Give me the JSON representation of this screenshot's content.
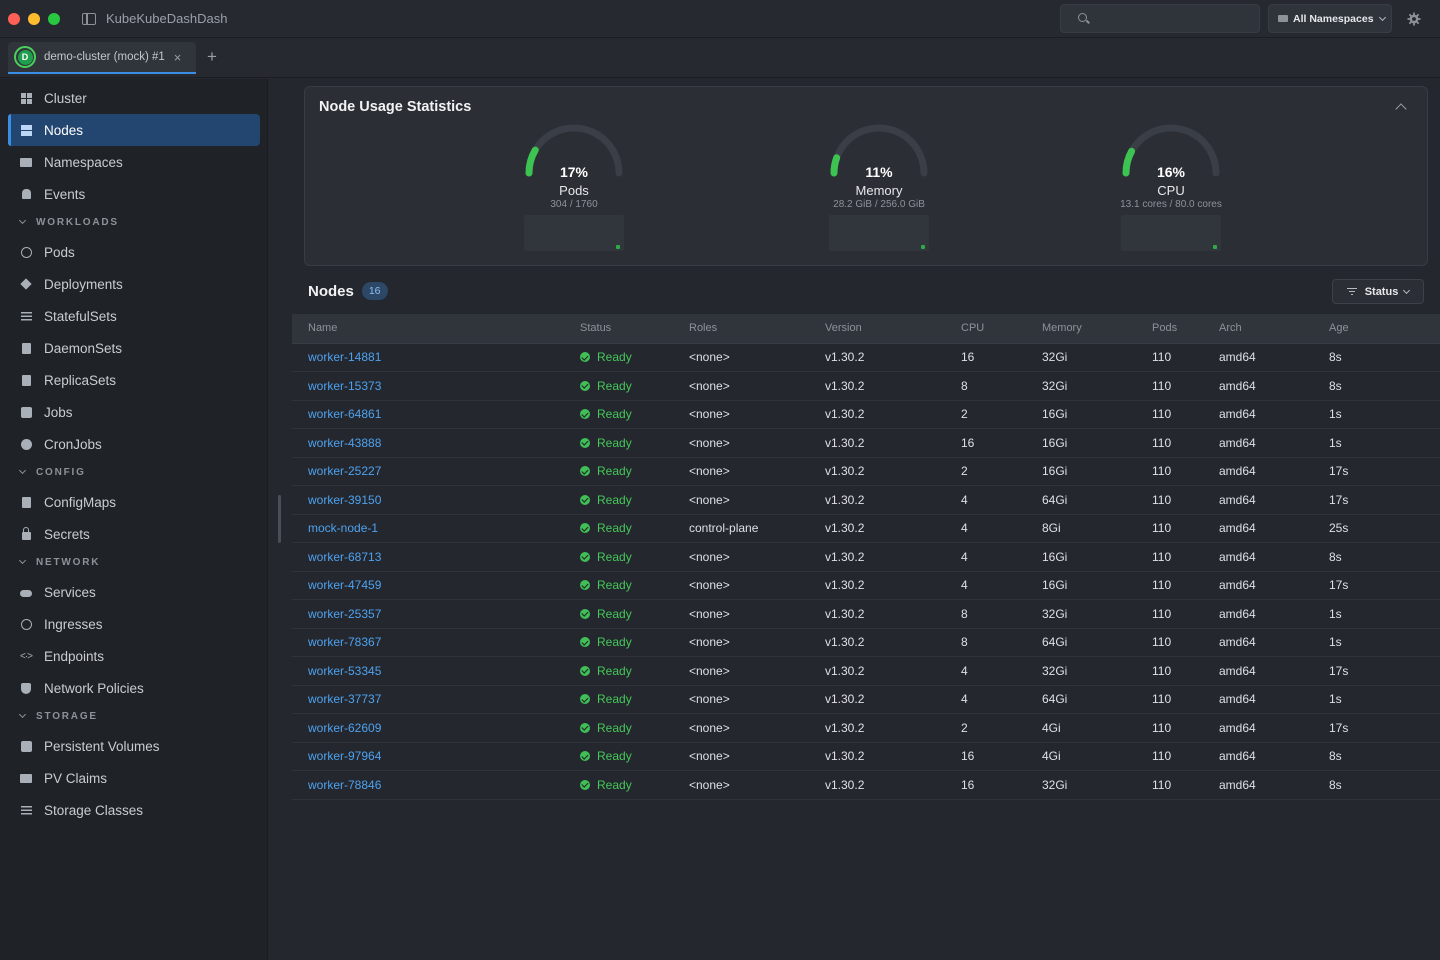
{
  "window": {
    "title": "KubeKubeDashDash"
  },
  "header": {
    "search": {
      "value": "",
      "placeholder": ""
    },
    "namespace_select": "All Namespaces"
  },
  "tabs": [
    {
      "label": "demo-cluster (mock) #1",
      "avatar_letter": "D",
      "active": true
    }
  ],
  "sidebar": {
    "items": [
      {
        "label": "Cluster",
        "icon": "grid-icon"
      },
      {
        "label": "Nodes",
        "icon": "server-icon",
        "active": true
      },
      {
        "label": "Namespaces",
        "icon": "folder-icon"
      },
      {
        "label": "Events",
        "icon": "bell-icon"
      }
    ],
    "sections": [
      {
        "title": "WORKLOADS",
        "items": [
          {
            "label": "Pods",
            "icon": "pod-icon"
          },
          {
            "label": "Deployments",
            "icon": "layers-icon"
          },
          {
            "label": "StatefulSets",
            "icon": "list-icon"
          },
          {
            "label": "DaemonSets",
            "icon": "copy-icon"
          },
          {
            "label": "ReplicaSets",
            "icon": "doc-icon"
          },
          {
            "label": "Jobs",
            "icon": "briefcase-icon"
          },
          {
            "label": "CronJobs",
            "icon": "clock-icon"
          }
        ]
      },
      {
        "title": "CONFIG",
        "items": [
          {
            "label": "ConfigMaps",
            "icon": "file-icon"
          },
          {
            "label": "Secrets",
            "icon": "lock-icon"
          }
        ]
      },
      {
        "title": "NETWORK",
        "items": [
          {
            "label": "Services",
            "icon": "cloud-icon"
          },
          {
            "label": "Ingresses",
            "icon": "globe-icon"
          },
          {
            "label": "Endpoints",
            "icon": "code-icon"
          },
          {
            "label": "Network Policies",
            "icon": "shield-icon"
          }
        ]
      },
      {
        "title": "STORAGE",
        "items": [
          {
            "label": "Persistent Volumes",
            "icon": "disk-icon"
          },
          {
            "label": "PV Claims",
            "icon": "folder-open-icon"
          },
          {
            "label": "Storage Classes",
            "icon": "list-icon"
          }
        ]
      }
    ]
  },
  "stats": {
    "title": "Node Usage Statistics",
    "gauges": [
      {
        "percent_label": "17%",
        "percent": 17,
        "label": "Pods",
        "detail": "304 / 1760"
      },
      {
        "percent_label": "11%",
        "percent": 11,
        "label": "Memory",
        "detail": "28.2 GiB / 256.0 GiB"
      },
      {
        "percent_label": "16%",
        "percent": 16,
        "label": "CPU",
        "detail": "13.1 cores / 80.0 cores"
      }
    ],
    "colors": {
      "track": "#3a3e46",
      "fill": "#3cc351"
    }
  },
  "nodes": {
    "title": "Nodes",
    "count": "16",
    "filter_label": "Status",
    "columns": [
      "Name",
      "Status",
      "Roles",
      "Version",
      "CPU",
      "Memory",
      "Pods",
      "Arch",
      "Age"
    ],
    "rows": [
      [
        "worker-14881",
        "Ready",
        "<none>",
        "v1.30.2",
        "16",
        "32Gi",
        "110",
        "amd64",
        "8s"
      ],
      [
        "worker-15373",
        "Ready",
        "<none>",
        "v1.30.2",
        "8",
        "32Gi",
        "110",
        "amd64",
        "8s"
      ],
      [
        "worker-64861",
        "Ready",
        "<none>",
        "v1.30.2",
        "2",
        "16Gi",
        "110",
        "amd64",
        "1s"
      ],
      [
        "worker-43888",
        "Ready",
        "<none>",
        "v1.30.2",
        "16",
        "16Gi",
        "110",
        "amd64",
        "1s"
      ],
      [
        "worker-25227",
        "Ready",
        "<none>",
        "v1.30.2",
        "2",
        "16Gi",
        "110",
        "amd64",
        "17s"
      ],
      [
        "worker-39150",
        "Ready",
        "<none>",
        "v1.30.2",
        "4",
        "64Gi",
        "110",
        "amd64",
        "17s"
      ],
      [
        "mock-node-1",
        "Ready",
        "control-plane",
        "v1.30.2",
        "4",
        "8Gi",
        "110",
        "amd64",
        "25s"
      ],
      [
        "worker-68713",
        "Ready",
        "<none>",
        "v1.30.2",
        "4",
        "16Gi",
        "110",
        "amd64",
        "8s"
      ],
      [
        "worker-47459",
        "Ready",
        "<none>",
        "v1.30.2",
        "4",
        "16Gi",
        "110",
        "amd64",
        "17s"
      ],
      [
        "worker-25357",
        "Ready",
        "<none>",
        "v1.30.2",
        "8",
        "32Gi",
        "110",
        "amd64",
        "1s"
      ],
      [
        "worker-78367",
        "Ready",
        "<none>",
        "v1.30.2",
        "8",
        "64Gi",
        "110",
        "amd64",
        "1s"
      ],
      [
        "worker-53345",
        "Ready",
        "<none>",
        "v1.30.2",
        "4",
        "32Gi",
        "110",
        "amd64",
        "17s"
      ],
      [
        "worker-37737",
        "Ready",
        "<none>",
        "v1.30.2",
        "4",
        "64Gi",
        "110",
        "amd64",
        "1s"
      ],
      [
        "worker-62609",
        "Ready",
        "<none>",
        "v1.30.2",
        "2",
        "4Gi",
        "110",
        "amd64",
        "17s"
      ],
      [
        "worker-97964",
        "Ready",
        "<none>",
        "v1.30.2",
        "16",
        "4Gi",
        "110",
        "amd64",
        "8s"
      ],
      [
        "worker-78846",
        "Ready",
        "<none>",
        "v1.30.2",
        "16",
        "32Gi",
        "110",
        "amd64",
        "8s"
      ]
    ],
    "colors": {
      "name": "#4ea2f0",
      "ready": "#46c75a"
    }
  }
}
